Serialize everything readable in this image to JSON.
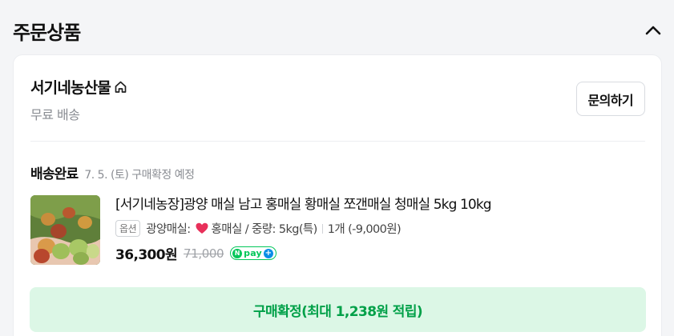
{
  "section": {
    "title": "주문상품",
    "collapse_icon": "chevron-up-icon"
  },
  "seller": {
    "name": "서기네농산물",
    "home_icon": "home-icon",
    "shipping": "무료 배송",
    "inquiry_label": "문의하기"
  },
  "order": {
    "status": "배송완료",
    "status_detail": "7. 5. (토) 구매확정 예정"
  },
  "product": {
    "title": "[서기네농장]광양 매실 남고 홍매실 황매실 쪼갠매실 청매실 5kg 10kg",
    "option_chip": "옵션",
    "option_prefix": "광양매실:",
    "option_value": "홍매실 / 중량: 5kg(특)",
    "quantity": "1개 (-9,000원)",
    "price": "36,300원",
    "original_price": "71,000",
    "npay_text": "pay",
    "colors": {
      "npay_green": "#03c75a",
      "npay_plus": "#0a8ee6",
      "heart": "#e8305a"
    }
  },
  "actions": {
    "confirm_label": "구매확정(최대 1,238원 적립)"
  },
  "colors": {
    "confirm_bg": "#dcf7e6",
    "confirm_text": "#00a048"
  }
}
